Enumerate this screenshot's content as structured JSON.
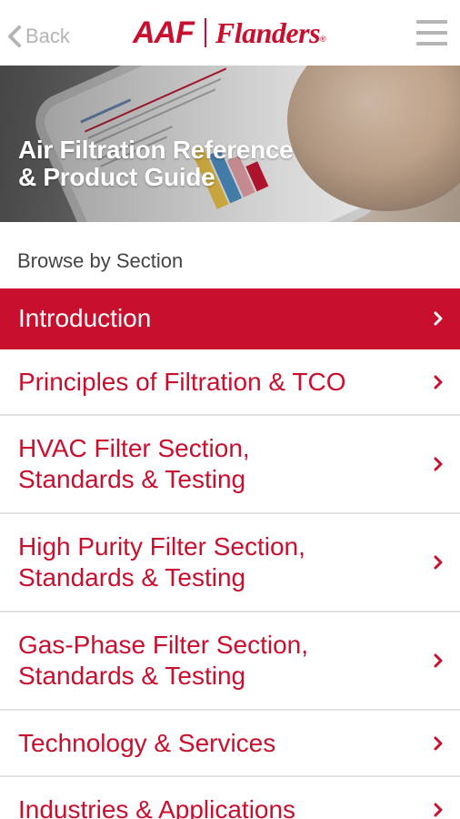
{
  "header": {
    "back_label": "Back",
    "logo_left": "AAF",
    "logo_right": "Flanders",
    "logo_reg": "®",
    "menu_icon": "hamburger-menu-icon"
  },
  "hero": {
    "title_line1": "Air Filtration Reference",
    "title_line2": "& Product Guide"
  },
  "browse": {
    "label": "Browse by Section"
  },
  "sections": [
    {
      "line1": "Introduction",
      "line2": ""
    },
    {
      "line1": "Principles of Filtration & TCO",
      "line2": ""
    },
    {
      "line1": "HVAC Filter Section,",
      "line2": "Standards & Testing"
    },
    {
      "line1": "High Purity Filter Section,",
      "line2": "Standards & Testing"
    },
    {
      "line1": "Gas-Phase Filter Section,",
      "line2": "Standards & Testing"
    },
    {
      "line1": "Technology & Services",
      "line2": ""
    },
    {
      "line1": "Industries & Applications",
      "line2": ""
    }
  ],
  "colors": {
    "brand_red": "#c8102e",
    "header_icon_gray": "#b4b4b4",
    "divider": "#e3e3e3"
  }
}
